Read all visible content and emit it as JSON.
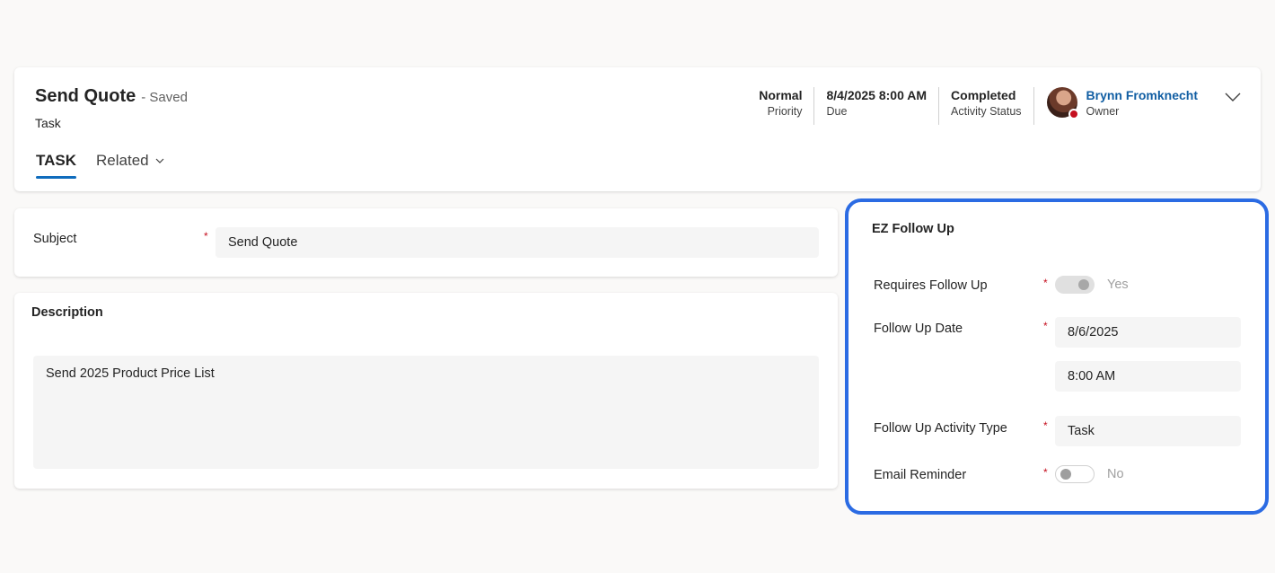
{
  "record": {
    "title": "Send Quote",
    "saved_status": "- Saved",
    "entity_type": "Task"
  },
  "tabs": [
    {
      "label": "TASK"
    },
    {
      "label": "Related"
    }
  ],
  "header_fields": [
    {
      "value": "Normal",
      "label": "Priority"
    },
    {
      "value": "8/4/2025 8:00 AM",
      "label": "Due"
    },
    {
      "value": "Completed",
      "label": "Activity Status"
    }
  ],
  "owner": {
    "name": "Brynn Fromknecht",
    "label": "Owner",
    "presence_color": "#c50f1f"
  },
  "subject": {
    "label": "Subject",
    "value": "Send Quote"
  },
  "description": {
    "title": "Description",
    "value": "Send 2025 Product Price List"
  },
  "follow_up": {
    "title": "EZ Follow Up",
    "requires_follow_up": {
      "label": "Requires Follow Up",
      "value": "Yes",
      "on": true
    },
    "follow_up_date": {
      "label": "Follow Up Date",
      "date": "8/6/2025",
      "time": "8:00 AM"
    },
    "activity_type": {
      "label": "Follow Up Activity Type",
      "value": "Task"
    },
    "email_reminder": {
      "label": "Email Reminder",
      "value": "No",
      "on": false
    }
  },
  "required_marker": "*",
  "colors": {
    "accent": "#0f6cbd",
    "highlight_border": "#2b6be3",
    "required": "#c50f1f",
    "owner_link": "#115ea3"
  }
}
